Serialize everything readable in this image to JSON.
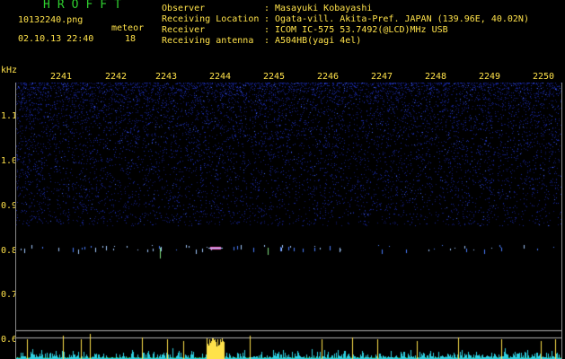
{
  "header": {
    "app_title": "HROFFT",
    "file_name": "10132240.png",
    "datetime": "02.10.13 22:40",
    "meteor_label": "meteor",
    "meteor_count": "18"
  },
  "info": [
    {
      "label": "Observer",
      "value": "Masayuki Kobayashi"
    },
    {
      "label": "Receiving Location",
      "value": "Ogata-vill. Akita-Pref. JAPAN (139.96E, 40.02N)"
    },
    {
      "label": "Receiver",
      "value": "ICOM IC-575 53.7492(@LCD)MHz USB"
    },
    {
      "label": "Receiving antenna",
      "value": "A504HB(yagi 4el)"
    }
  ],
  "plot": {
    "unit_label": "kHz",
    "time_ticks": [
      "2241",
      "2242",
      "2243",
      "2244",
      "2245",
      "2246",
      "2247",
      "2248",
      "2249",
      "2250"
    ],
    "freq_ticks": [
      {
        "label": "1.1",
        "value": 1.1
      },
      {
        "label": "1.0",
        "value": 1.0
      },
      {
        "label": "0.9",
        "value": 0.9
      },
      {
        "label": "0.8",
        "value": 0.8
      },
      {
        "label": "0.7",
        "value": 0.7
      },
      {
        "label": "0.6",
        "value": 0.6
      }
    ],
    "colors": {
      "noise": "#1a2aa8",
      "echo": "#a0c8ff",
      "echo_hot": "#ff60c0",
      "spectrum": "#2ecfe0",
      "spectrum_peak": "#ffe24a",
      "reference_line": "#b0b0b0",
      "baseline": "#0f6b0f"
    }
  }
}
